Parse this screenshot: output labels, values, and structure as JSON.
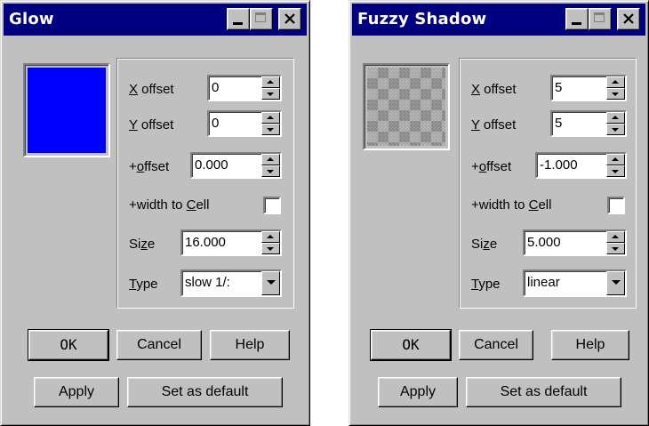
{
  "glow": {
    "title": "Glow",
    "swatch_color": "#0000ff",
    "fields": {
      "x_offset": {
        "label": "X offset",
        "value": "0"
      },
      "y_offset": {
        "label": "Y offset",
        "value": "0"
      },
      "plus_offset": {
        "label": "+offset",
        "value": "0.000"
      },
      "width_to_cell": {
        "label": "+width to Cell",
        "checked": false
      },
      "size": {
        "label": "Size",
        "value": "16.000"
      },
      "type": {
        "label": "Type",
        "value": "slow 1/:"
      }
    },
    "buttons": {
      "ok": "OK",
      "cancel": "Cancel",
      "help": "Help",
      "apply": "Apply",
      "set_default": "Set as default"
    }
  },
  "fuzzy": {
    "title": "Fuzzy Shadow",
    "swatch": "checkered-gray-pattern",
    "fields": {
      "x_offset": {
        "label": "X offset",
        "value": "5"
      },
      "y_offset": {
        "label": "Y offset",
        "value": "5"
      },
      "plus_offset": {
        "label": "+offset",
        "value": "-1.000"
      },
      "width_to_cell": {
        "label": "+width to Cell",
        "checked": false
      },
      "size": {
        "label": "Size",
        "value": "5.000"
      },
      "type": {
        "label": "Type",
        "value": "linear"
      }
    },
    "buttons": {
      "ok": "OK",
      "cancel": "Cancel",
      "help": "Help",
      "apply": "Apply",
      "set_default": "Set as default"
    }
  }
}
